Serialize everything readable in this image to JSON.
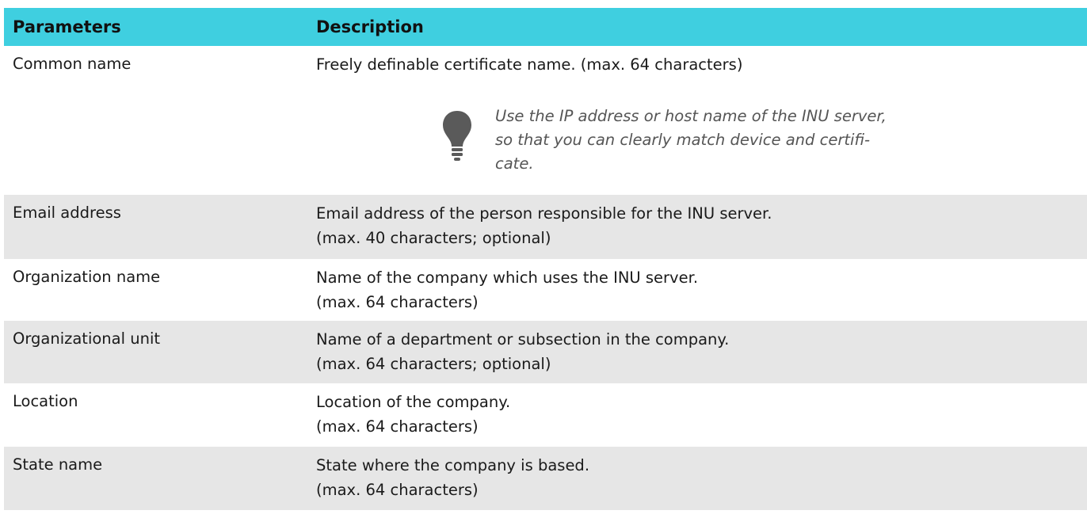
{
  "table": {
    "headers": {
      "parameters": "Parameters",
      "description": "Description"
    },
    "rows": [
      {
        "parameter": "Common name",
        "description": [
          "Freely definable certificate name. (max. 64 characters)"
        ],
        "tip": [
          "Use the IP address or host name of the INU server,",
          "so that you can clearly match device and certifi-",
          "cate."
        ]
      },
      {
        "parameter": "Email address",
        "description": [
          "Email address of the person responsible for the INU server.",
          "(max. 40 characters; optional)"
        ]
      },
      {
        "parameter": "Organization name",
        "description": [
          "Name of the company which uses the INU server.",
          "(max. 64 characters)"
        ]
      },
      {
        "parameter": "Organizational unit",
        "description": [
          "Name of a department or subsection in the company.",
          "(max. 64 characters; optional)"
        ]
      },
      {
        "parameter": "Location",
        "description": [
          "Location of the company.",
          "(max. 64 characters)"
        ]
      },
      {
        "parameter": "State name",
        "description": [
          "State where the company is based.",
          "(max. 64 characters)"
        ]
      }
    ]
  },
  "colors": {
    "header_bg": "#3fcfe0",
    "row_gray": "#e6e6e6",
    "row_white": "#ffffff",
    "bulb": "#5a5a5a"
  },
  "icons": {
    "tip": "lightbulb-icon"
  }
}
